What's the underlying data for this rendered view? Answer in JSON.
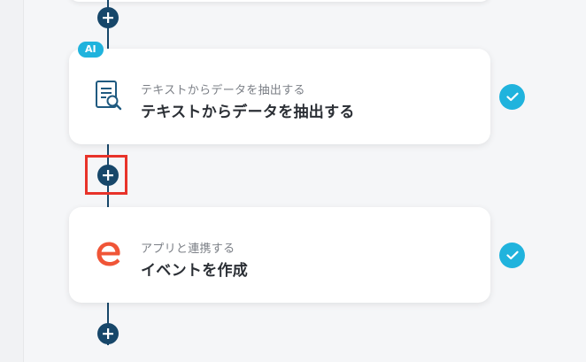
{
  "flow": {
    "steps": [
      {
        "badge": "AI",
        "subtitle": "テキストからデータを抽出する",
        "title": "テキストからデータを抽出する",
        "icon": "document-search-icon",
        "status": "completed"
      },
      {
        "badge": "",
        "subtitle": "アプリと連携する",
        "title": "イベントを作成",
        "icon": "eventbrite-e-icon",
        "status": "completed"
      }
    ],
    "add_step_icon": "plus-icon",
    "highlighted_add_button_index": 1
  },
  "colors": {
    "connector": "#17476a",
    "check": "#20b3dd",
    "ai_badge": "#20b3dd",
    "highlight": "#e8332a",
    "eventbrite_orange": "#f05537",
    "doc_icon": "#1f5a80"
  }
}
